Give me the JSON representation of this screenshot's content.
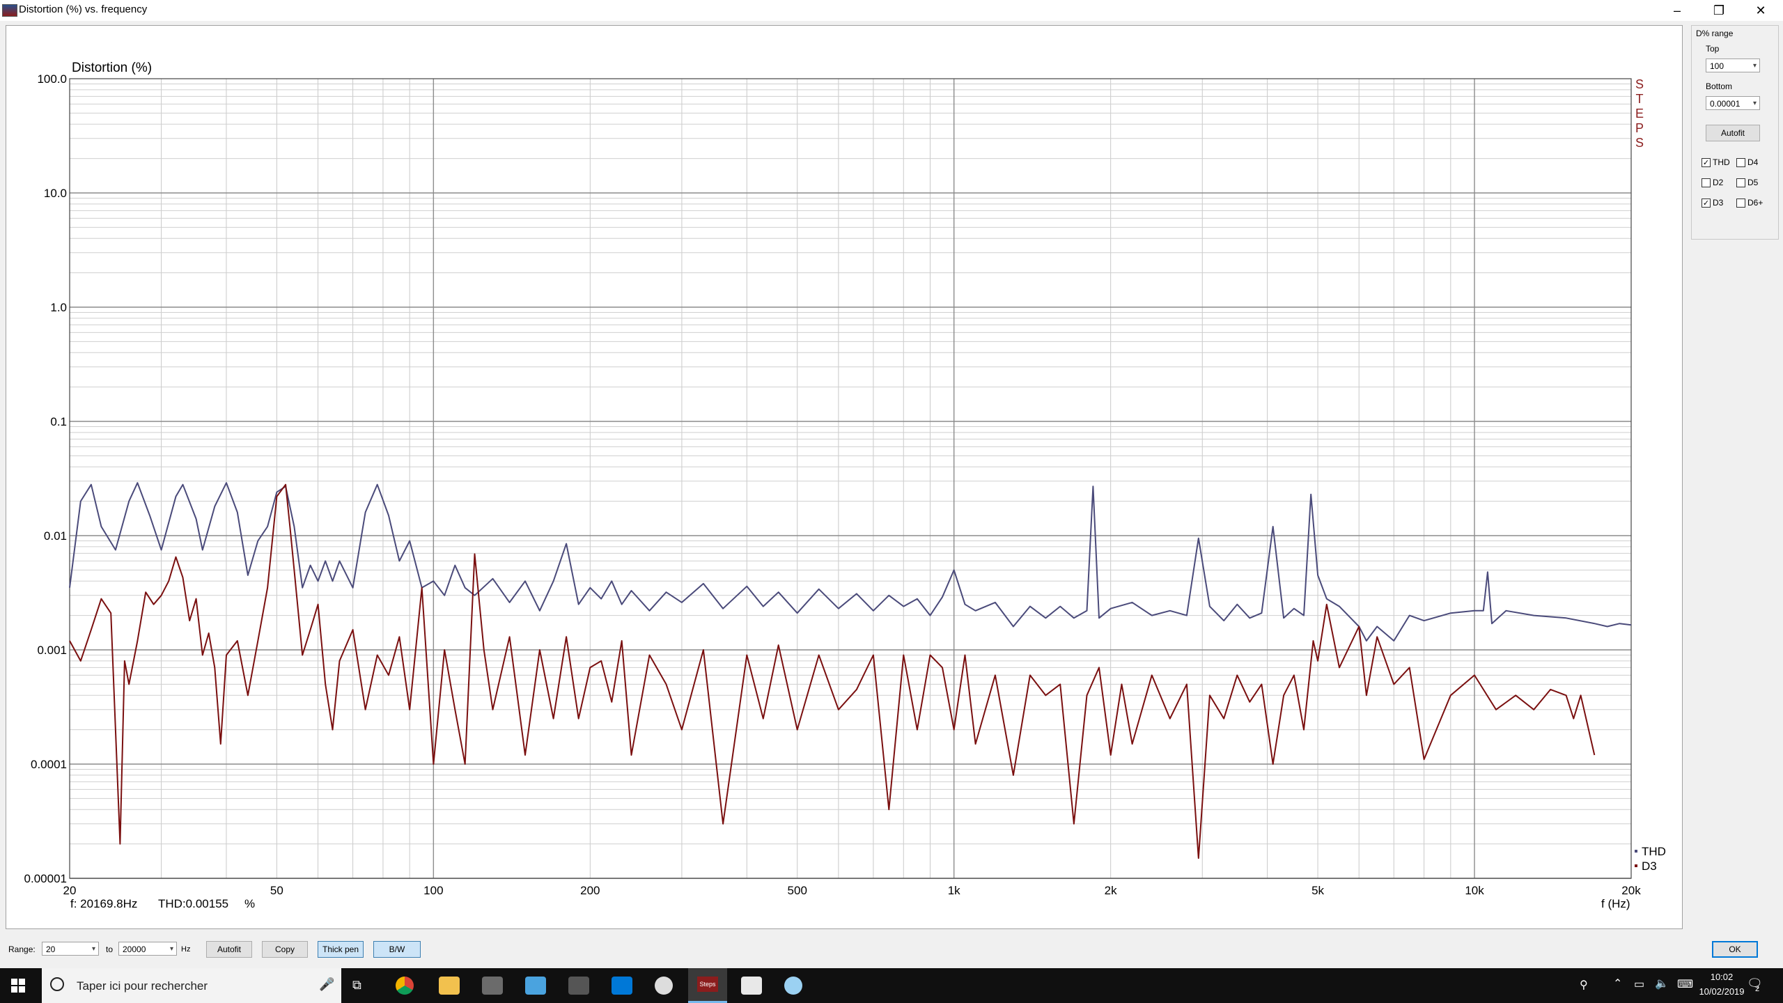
{
  "window": {
    "title": "Distortion (%) vs. frequency",
    "controls": [
      "–",
      "❐",
      "✕"
    ]
  },
  "chart_data": {
    "type": "line",
    "title": "Distortion (%)",
    "xlabel": "f (Hz)",
    "ylabel": "Distortion (%)",
    "x_scale": "log",
    "y_scale": "log",
    "xlim": [
      20,
      20000
    ],
    "ylim": [
      1e-05,
      100
    ],
    "grid": true,
    "legend_position": "bottom-right",
    "watermark": "STEPS",
    "y_tick_labels": [
      "100.0",
      "10.0",
      "1.0",
      "0.1",
      "0.01",
      "0.001",
      "0.0001",
      "0.00001"
    ],
    "x_tick_labels": [
      {
        "v": 20,
        "t": "20"
      },
      {
        "v": 50,
        "t": "50"
      },
      {
        "v": 100,
        "t": "100"
      },
      {
        "v": 200,
        "t": "200"
      },
      {
        "v": 500,
        "t": "500"
      },
      {
        "v": 1000,
        "t": "1k"
      },
      {
        "v": 2000,
        "t": "2k"
      },
      {
        "v": 5000,
        "t": "5k"
      },
      {
        "v": 10000,
        "t": "10k"
      },
      {
        "v": 20000,
        "t": "20k"
      }
    ],
    "series": [
      {
        "name": "THD",
        "color": "#4a4a7a",
        "points": [
          [
            20,
            0.0035
          ],
          [
            21,
            0.02
          ],
          [
            22,
            0.028
          ],
          [
            23,
            0.012
          ],
          [
            24.5,
            0.0075
          ],
          [
            26,
            0.02
          ],
          [
            27,
            0.029
          ],
          [
            28.5,
            0.015
          ],
          [
            30,
            0.0075
          ],
          [
            32,
            0.022
          ],
          [
            33,
            0.028
          ],
          [
            35,
            0.014
          ],
          [
            36,
            0.0075
          ],
          [
            38,
            0.018
          ],
          [
            40,
            0.029
          ],
          [
            42,
            0.016
          ],
          [
            44,
            0.0045
          ],
          [
            46,
            0.009
          ],
          [
            48,
            0.012
          ],
          [
            50,
            0.024
          ],
          [
            52,
            0.027
          ],
          [
            54,
            0.012
          ],
          [
            56,
            0.0035
          ],
          [
            58,
            0.0055
          ],
          [
            60,
            0.004
          ],
          [
            62,
            0.006
          ],
          [
            64,
            0.004
          ],
          [
            66,
            0.006
          ],
          [
            70,
            0.0035
          ],
          [
            74,
            0.016
          ],
          [
            78,
            0.028
          ],
          [
            82,
            0.015
          ],
          [
            86,
            0.006
          ],
          [
            90,
            0.009
          ],
          [
            95,
            0.0035
          ],
          [
            100,
            0.004
          ],
          [
            105,
            0.003
          ],
          [
            110,
            0.0055
          ],
          [
            115,
            0.0035
          ],
          [
            120,
            0.003
          ],
          [
            130,
            0.0042
          ],
          [
            140,
            0.0026
          ],
          [
            150,
            0.004
          ],
          [
            160,
            0.0022
          ],
          [
            170,
            0.004
          ],
          [
            180,
            0.0085
          ],
          [
            190,
            0.0025
          ],
          [
            200,
            0.0035
          ],
          [
            210,
            0.0028
          ],
          [
            220,
            0.004
          ],
          [
            230,
            0.0025
          ],
          [
            240,
            0.0033
          ],
          [
            260,
            0.0022
          ],
          [
            280,
            0.0032
          ],
          [
            300,
            0.0026
          ],
          [
            330,
            0.0038
          ],
          [
            360,
            0.0023
          ],
          [
            400,
            0.0036
          ],
          [
            430,
            0.0024
          ],
          [
            460,
            0.0032
          ],
          [
            500,
            0.0021
          ],
          [
            550,
            0.0034
          ],
          [
            600,
            0.0023
          ],
          [
            650,
            0.0031
          ],
          [
            700,
            0.0022
          ],
          [
            750,
            0.003
          ],
          [
            800,
            0.0024
          ],
          [
            850,
            0.0028
          ],
          [
            900,
            0.002
          ],
          [
            950,
            0.0029
          ],
          [
            1000,
            0.005
          ],
          [
            1050,
            0.0025
          ],
          [
            1100,
            0.0022
          ],
          [
            1200,
            0.0026
          ],
          [
            1300,
            0.0016
          ],
          [
            1400,
            0.0024
          ],
          [
            1500,
            0.0019
          ],
          [
            1600,
            0.0024
          ],
          [
            1700,
            0.0019
          ],
          [
            1800,
            0.0022
          ],
          [
            1850,
            0.027
          ],
          [
            1900,
            0.0019
          ],
          [
            2000,
            0.0023
          ],
          [
            2200,
            0.0026
          ],
          [
            2400,
            0.002
          ],
          [
            2600,
            0.0022
          ],
          [
            2800,
            0.002
          ],
          [
            2950,
            0.0095
          ],
          [
            3100,
            0.0024
          ],
          [
            3300,
            0.0018
          ],
          [
            3500,
            0.0025
          ],
          [
            3700,
            0.0019
          ],
          [
            3900,
            0.0021
          ],
          [
            4100,
            0.012
          ],
          [
            4300,
            0.0019
          ],
          [
            4500,
            0.0023
          ],
          [
            4700,
            0.002
          ],
          [
            4850,
            0.023
          ],
          [
            5000,
            0.0045
          ],
          [
            5200,
            0.0028
          ],
          [
            5500,
            0.0024
          ],
          [
            6000,
            0.0016
          ],
          [
            6200,
            0.0012
          ],
          [
            6500,
            0.0016
          ],
          [
            7000,
            0.0012
          ],
          [
            7500,
            0.002
          ],
          [
            8000,
            0.0018
          ],
          [
            9000,
            0.0021
          ],
          [
            10000,
            0.0022
          ],
          [
            10400,
            0.0022
          ],
          [
            10600,
            0.0048
          ],
          [
            10800,
            0.0017
          ],
          [
            11500,
            0.0022
          ],
          [
            13000,
            0.002
          ],
          [
            15000,
            0.0019
          ],
          [
            17000,
            0.0017
          ],
          [
            18000,
            0.0016
          ],
          [
            19000,
            0.0017
          ],
          [
            20000,
            0.00165
          ]
        ]
      },
      {
        "name": "D3",
        "color": "#7a0f0f",
        "points": [
          [
            20,
            0.0012
          ],
          [
            21,
            0.0008
          ],
          [
            22,
            0.0015
          ],
          [
            23,
            0.0028
          ],
          [
            24,
            0.0021
          ],
          [
            25,
            2e-05
          ],
          [
            25.5,
            0.0008
          ],
          [
            26,
            0.0005
          ],
          [
            27,
            0.0012
          ],
          [
            28,
            0.0032
          ],
          [
            29,
            0.0025
          ],
          [
            30,
            0.003
          ],
          [
            31,
            0.004
          ],
          [
            32,
            0.0065
          ],
          [
            33,
            0.0043
          ],
          [
            34,
            0.0018
          ],
          [
            35,
            0.0028
          ],
          [
            36,
            0.0009
          ],
          [
            37,
            0.0014
          ],
          [
            38,
            0.0007
          ],
          [
            39,
            0.00015
          ],
          [
            40,
            0.0009
          ],
          [
            42,
            0.0012
          ],
          [
            44,
            0.0004
          ],
          [
            46,
            0.0012
          ],
          [
            48,
            0.0035
          ],
          [
            50,
            0.022
          ],
          [
            52,
            0.028
          ],
          [
            53,
            0.012
          ],
          [
            54,
            0.005
          ],
          [
            56,
            0.0009
          ],
          [
            58,
            0.0015
          ],
          [
            60,
            0.0025
          ],
          [
            62,
            0.0005
          ],
          [
            64,
            0.0002
          ],
          [
            66,
            0.0008
          ],
          [
            70,
            0.0015
          ],
          [
            74,
            0.0003
          ],
          [
            78,
            0.0009
          ],
          [
            82,
            0.0006
          ],
          [
            86,
            0.0013
          ],
          [
            90,
            0.0003
          ],
          [
            95,
            0.0035
          ],
          [
            100,
            0.0001
          ],
          [
            105,
            0.001
          ],
          [
            110,
            0.0003
          ],
          [
            115,
            0.0001
          ],
          [
            120,
            0.0069
          ],
          [
            125,
            0.001
          ],
          [
            130,
            0.0003
          ],
          [
            140,
            0.0013
          ],
          [
            150,
            0.00012
          ],
          [
            160,
            0.001
          ],
          [
            170,
            0.00025
          ],
          [
            180,
            0.0013
          ],
          [
            190,
            0.00025
          ],
          [
            200,
            0.0007
          ],
          [
            210,
            0.0008
          ],
          [
            220,
            0.00035
          ],
          [
            230,
            0.0012
          ],
          [
            240,
            0.00012
          ],
          [
            260,
            0.0009
          ],
          [
            280,
            0.0005
          ],
          [
            300,
            0.0002
          ],
          [
            330,
            0.001
          ],
          [
            360,
            3e-05
          ],
          [
            400,
            0.0009
          ],
          [
            430,
            0.00025
          ],
          [
            460,
            0.0011
          ],
          [
            500,
            0.0002
          ],
          [
            550,
            0.0009
          ],
          [
            600,
            0.0003
          ],
          [
            650,
            0.00045
          ],
          [
            700,
            0.0009
          ],
          [
            750,
            4e-05
          ],
          [
            800,
            0.0009
          ],
          [
            850,
            0.0002
          ],
          [
            900,
            0.0009
          ],
          [
            950,
            0.0007
          ],
          [
            1000,
            0.0002
          ],
          [
            1050,
            0.0009
          ],
          [
            1100,
            0.00015
          ],
          [
            1200,
            0.0006
          ],
          [
            1300,
            8e-05
          ],
          [
            1400,
            0.0006
          ],
          [
            1500,
            0.0004
          ],
          [
            1600,
            0.0005
          ],
          [
            1700,
            3e-05
          ],
          [
            1800,
            0.0004
          ],
          [
            1900,
            0.0007
          ],
          [
            2000,
            0.00012
          ],
          [
            2100,
            0.0005
          ],
          [
            2200,
            0.00015
          ],
          [
            2400,
            0.0006
          ],
          [
            2600,
            0.00025
          ],
          [
            2800,
            0.0005
          ],
          [
            2950,
            1.5e-05
          ],
          [
            3100,
            0.0004
          ],
          [
            3300,
            0.00025
          ],
          [
            3500,
            0.0006
          ],
          [
            3700,
            0.00035
          ],
          [
            3900,
            0.0005
          ],
          [
            4100,
            0.0001
          ],
          [
            4300,
            0.0004
          ],
          [
            4500,
            0.0006
          ],
          [
            4700,
            0.0002
          ],
          [
            4900,
            0.0012
          ],
          [
            5000,
            0.0008
          ],
          [
            5200,
            0.0025
          ],
          [
            5500,
            0.0007
          ],
          [
            6000,
            0.0016
          ],
          [
            6200,
            0.0004
          ],
          [
            6500,
            0.0013
          ],
          [
            7000,
            0.0005
          ],
          [
            7500,
            0.0007
          ],
          [
            8000,
            0.00011
          ],
          [
            9000,
            0.0004
          ],
          [
            10000,
            0.0006
          ],
          [
            11000,
            0.0003
          ],
          [
            12000,
            0.0004
          ],
          [
            13000,
            0.0003
          ],
          [
            14000,
            0.00045
          ],
          [
            15000,
            0.0004
          ],
          [
            15500,
            0.00025
          ],
          [
            16000,
            0.0004
          ],
          [
            17000,
            0.00012
          ]
        ]
      }
    ]
  },
  "readout": {
    "freq": "f: 20169.8Hz",
    "value": "THD:0.00155",
    "unit": "%"
  },
  "right_panel": {
    "group_label": "D% range",
    "top_label": "Top",
    "top_value": "100",
    "bottom_label": "Bottom",
    "bottom_value": "0.00001",
    "autofit_label": "Autofit",
    "checkboxes": [
      {
        "label": "THD",
        "checked": true
      },
      {
        "label": "D4",
        "checked": false
      },
      {
        "label": "D2",
        "checked": false
      },
      {
        "label": "D5",
        "checked": false
      },
      {
        "label": "D3",
        "checked": true
      },
      {
        "label": "D6+",
        "checked": false
      }
    ]
  },
  "bottom_bar": {
    "range_label": "Range:",
    "from_value": "20",
    "to_label": "to",
    "to_value": "20000",
    "unit_label": "Hz",
    "autofit_label": "Autofit",
    "copy_label": "Copy",
    "thick_pen_label": "Thick pen",
    "bw_label": "B/W",
    "ok_label": "OK"
  },
  "taskbar": {
    "search_placeholder": "Taper ici pour rechercher",
    "time": "10:02",
    "date": "10/02/2019",
    "notification_count": "2",
    "steps_icon_label": "Steps"
  }
}
